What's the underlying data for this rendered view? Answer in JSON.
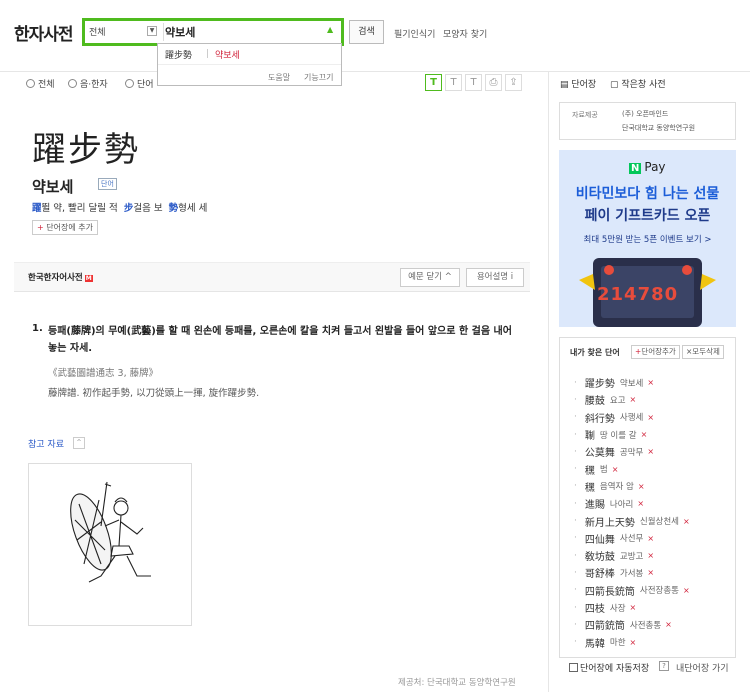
{
  "header": {
    "title": "한자사전",
    "category": "전체",
    "query": "약보세",
    "search_label": "검색",
    "handwriting_label": "필기인식기",
    "shape_label": "모양자 찾기"
  },
  "autocomplete": {
    "hanja": "躍步勢",
    "hangul": "약보세",
    "help_label": "도움말",
    "off_label": "기능끄기"
  },
  "filters": {
    "options": [
      "전체",
      "음·한자",
      "단어"
    ]
  },
  "toolbar": {
    "font_icons": [
      "T",
      "T",
      "T"
    ],
    "print_icon": "⎙",
    "share_icon": "⇪"
  },
  "entry": {
    "hanja": "躍步勢",
    "reading": "약보세",
    "word_tag": "단어",
    "chars": [
      {
        "char": "躍",
        "meaning": "뛸 약, 빨리 달릴 적"
      },
      {
        "char": "步",
        "meaning": "걸음 보"
      },
      {
        "char": "勢",
        "meaning": "형세 세"
      }
    ],
    "add_button": "단어장에 추가"
  },
  "section": {
    "title": "한국한자어사전",
    "badge": "M",
    "example_toggle": "예문 닫기 ^",
    "term_help": "용어설명 i"
  },
  "definition": {
    "number": "1.",
    "text": "등패(藤牌)의 무예(武藝)를 할 때 왼손에 등패를, 오른손에 칼을 치켜 들고서 왼발을 들어 앞으로 한 걸음 내어 놓는 자세.",
    "source": "《武藝圖譜通志 3, 藤牌》",
    "example": "藤牌譜. 初作起手勢, 以刀從頭上一揮, 旋作躍步勢."
  },
  "reference": {
    "title": "참고 자료",
    "toggle": "^"
  },
  "footer": "제공처: 단국대학교 동양학연구원",
  "sidebar": {
    "wordbook_label": "단어장",
    "vocab_label": "작은창 사전",
    "providers_label": "자료제공",
    "provider_1": "(주) 오픈마인드",
    "provider_2": "단국대학교 동양학연구원",
    "ad": {
      "brand": "Pay",
      "brand_badge": "N",
      "headline_1": "비타민보다 힘 나는 선물",
      "headline_2": "페이 기프트카드 오픈",
      "sub": "최대 5만원 받는 5픈 이벤트 보기 >",
      "number": "214780"
    },
    "history": {
      "title": "내가 찾은 단어",
      "add_label": "단어장추가",
      "delete_all": "모두삭제",
      "items": [
        {
          "hanja": "躍步勢",
          "hangul": "약보세"
        },
        {
          "hanja": "腰鼓",
          "hangul": "요고"
        },
        {
          "hanja": "斜行勢",
          "hangul": "사행세"
        },
        {
          "hanja": "䎺",
          "hangul": "땅 이를 갈"
        },
        {
          "hanja": "公莫舞",
          "hangul": "공막무"
        },
        {
          "hanja": "䆀",
          "hangul": "범"
        },
        {
          "hanja": "䆀",
          "hangul": "음역자 암"
        },
        {
          "hanja": "進賜",
          "hangul": "나아리"
        },
        {
          "hanja": "新月上天勢",
          "hangul": "신월상천세"
        },
        {
          "hanja": "四仙舞",
          "hangul": "사선무"
        },
        {
          "hanja": "敎坊鼓",
          "hangul": "교방고"
        },
        {
          "hanja": "哥舒棒",
          "hangul": "가서봉"
        },
        {
          "hanja": "四箭長銃筒",
          "hangul": "사전장총통"
        },
        {
          "hanja": "四枝",
          "hangul": "사장"
        },
        {
          "hanja": "四箭銃筒",
          "hangul": "사전총통"
        },
        {
          "hanja": "馬韓",
          "hangul": "마한"
        }
      ]
    },
    "autosave_label": "단어장에 자동저장",
    "help_q": "?",
    "go_wordbook": "내단어장 가기"
  },
  "colors": {
    "accent": "#4fbb1e",
    "link_blue": "#2a59c7",
    "remove_red": "#d1233b"
  }
}
